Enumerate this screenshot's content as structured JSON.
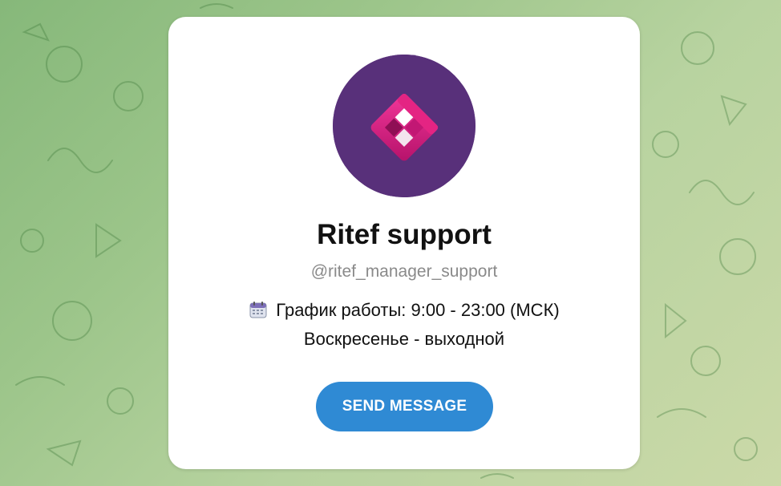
{
  "profile": {
    "name": "Ritef support",
    "username": "@ritef_manager_support",
    "schedule": "График работы: 9:00 - 23:00 (МСК)",
    "day_off": "Воскресенье - выходной"
  },
  "actions": {
    "send_label": "SEND MESSAGE"
  },
  "icons": {
    "schedule_icon": "calendar-icon",
    "avatar_logo": "ritef-logo-icon"
  },
  "colors": {
    "button": "#2f8ad4",
    "avatar_bg": "#58307a",
    "logo_pink": "#e0157a",
    "username": "#8a8a8a"
  }
}
